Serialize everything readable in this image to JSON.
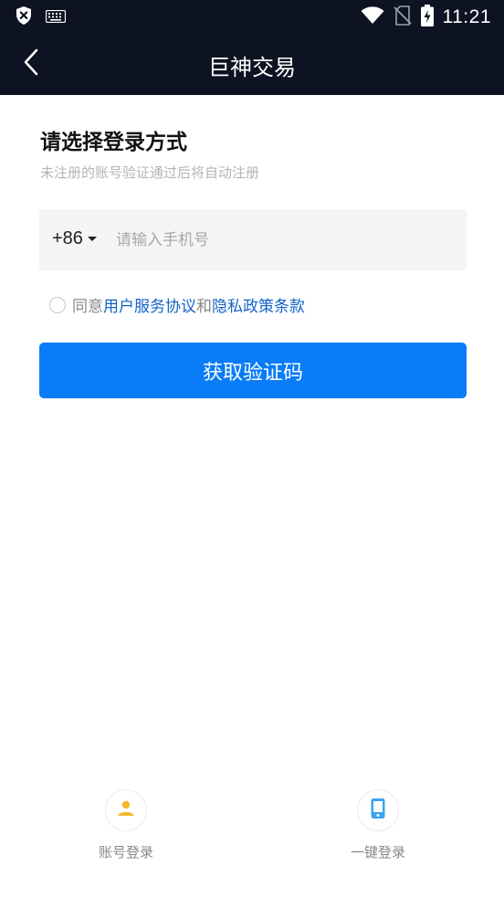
{
  "status_bar": {
    "time": "11:21",
    "icons": [
      "shield-x-icon",
      "keyboard-icon",
      "wifi-icon",
      "no-sim-icon",
      "battery-charging-icon"
    ]
  },
  "app_bar": {
    "title": "巨神交易",
    "back_icon": "chevron-left-icon"
  },
  "login": {
    "heading": "请选择登录方式",
    "subheading": "未注册的账号验证通过后将自动注册",
    "country_code": "+86",
    "phone_placeholder": "请输入手机号",
    "phone_value": "",
    "agree_prefix": "同意",
    "agree_terms": "用户服务协议",
    "agree_and": "和",
    "agree_privacy": "隐私政策条款",
    "submit_label": "获取验证码"
  },
  "alt_login": {
    "account_label": "账号登录",
    "onekey_label": "一键登录"
  },
  "colors": {
    "header_bg": "#0d1322",
    "primary": "#0a7cf8",
    "link": "#1463c8",
    "account_icon": "#f5b82e",
    "onekey_icon": "#3aa4f2"
  }
}
